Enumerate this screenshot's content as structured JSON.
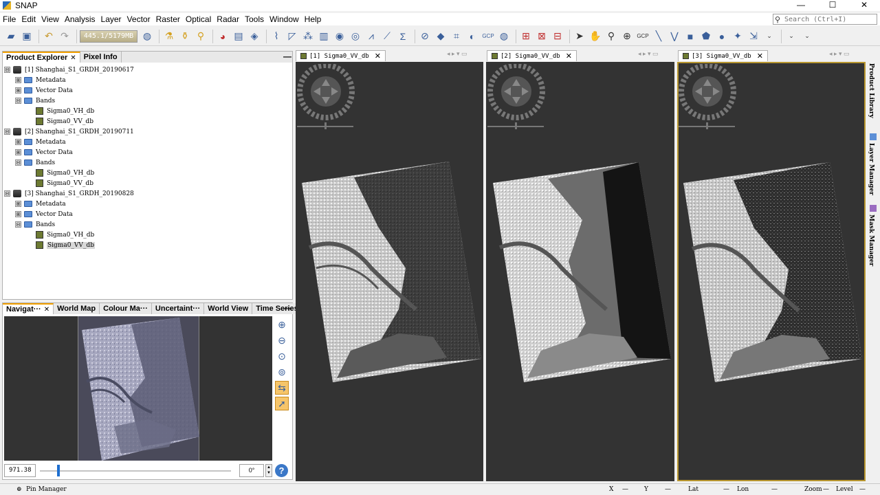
{
  "window": {
    "title": "SNAP",
    "minimize": "—",
    "maximize": "☐",
    "close": "✕"
  },
  "menu": [
    "File",
    "Edit",
    "View",
    "Analysis",
    "Layer",
    "Vector",
    "Raster",
    "Optical",
    "Radar",
    "Tools",
    "Window",
    "Help"
  ],
  "search": {
    "placeholder": "Search (Ctrl+I)",
    "icon": "search-icon"
  },
  "toolbar": {
    "memory": "445.1/5179MB"
  },
  "product_explorer": {
    "tabs": [
      "Product Explorer",
      "Pixel Info"
    ],
    "close": "✕",
    "minimize": "—",
    "products": [
      {
        "label": "[1] Shanghai_S1_GRDH_20190617",
        "metadata": "Metadata",
        "vector": "Vector Data",
        "bands": "Bands",
        "band_items": [
          "Sigma0_VH_db",
          "Sigma0_VV_db"
        ]
      },
      {
        "label": "[2] Shanghai_S1_GRDH_20190711",
        "metadata": "Metadata",
        "vector": "Vector Data",
        "bands": "Bands",
        "band_items": [
          "Sigma0_VH_db",
          "Sigma0_VV_db"
        ]
      },
      {
        "label": "[3] Shanghai_S1_GRDH_20190828",
        "metadata": "Metadata",
        "vector": "Vector Data",
        "bands": "Bands",
        "band_items": [
          "Sigma0_VH_db",
          "Sigma0_VV_db"
        ]
      }
    ],
    "expand_symbol": "⊟",
    "collapse_symbol": "⊞"
  },
  "navigation": {
    "tabs": [
      "Navigat···",
      "World Map",
      "Colour Ma···",
      "Uncertaint···",
      "World View",
      "Time Series"
    ],
    "close": "✕",
    "minimize": "—",
    "scale": "971.38",
    "angle": "0°",
    "spinner_up": "▲",
    "spinner_down": "▼",
    "help": "?",
    "slider_value": 0.09
  },
  "image_views": [
    {
      "tab": "[1] Sigma0_VV_db",
      "close": "✕",
      "selected": false
    },
    {
      "tab": "[2] Sigma0_VV_db",
      "close": "✕",
      "selected": false
    },
    {
      "tab": "[3] Sigma0_VV_db",
      "close": "✕",
      "selected": true
    }
  ],
  "tab_controls": "◂ ▸ ▾ ▭",
  "side_panels": [
    "Product Library",
    "Layer Manager",
    "Mask Manager"
  ],
  "status": {
    "pin_manager": "Pin Manager",
    "x": "X",
    "y": "Y",
    "lat": "Lat",
    "lon": "Lon",
    "zoom": "Zoom",
    "level": "Level",
    "dash": "—"
  },
  "colors": {
    "accent": "#f2a000",
    "selected_view_border": "#b8962e",
    "view_bg": "#333333",
    "folder": "#5c8fd6"
  }
}
